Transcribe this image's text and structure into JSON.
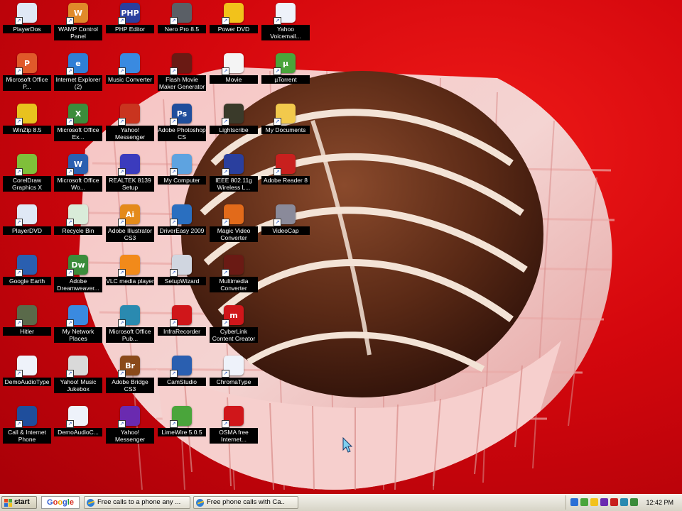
{
  "desktop": {
    "icons": [
      {
        "label": "PlayerDos",
        "icon": "dvd-disc-icon",
        "color": "#dfe8f5",
        "glyph": "",
        "col": 0,
        "row": 0
      },
      {
        "label": "WAMP Control Panel",
        "icon": "wamp-panel-icon",
        "color": "#e08a2a",
        "glyph": "W",
        "col": 1,
        "row": 0
      },
      {
        "label": "PHP Editor",
        "icon": "php-editor-icon",
        "color": "#2b3f9e",
        "glyph": "PHP",
        "col": 2,
        "row": 0
      },
      {
        "label": "Nero Pro 8.5",
        "icon": "disc-burner-icon",
        "color": "#5a5f66",
        "glyph": "",
        "col": 3,
        "row": 0
      },
      {
        "label": "Power DVD",
        "icon": "power-dvd-icon",
        "color": "#f2c21b",
        "glyph": "",
        "col": 4,
        "row": 0
      },
      {
        "label": "Yahoo Voicemail...",
        "icon": "document-icon",
        "color": "#eef2fa",
        "glyph": "",
        "col": 5,
        "row": 0
      },
      {
        "label": "Microsoft Office P...",
        "icon": "powerpoint-icon",
        "color": "#e0592a",
        "glyph": "P",
        "col": 0,
        "row": 1
      },
      {
        "label": "Internet Explorer (2)",
        "icon": "internet-explorer-icon",
        "color": "#2f7fd6",
        "glyph": "e",
        "col": 1,
        "row": 1
      },
      {
        "label": "Music Converter",
        "icon": "music-converter-icon",
        "color": "#3a8ae0",
        "glyph": "",
        "col": 2,
        "row": 1
      },
      {
        "label": "Flash Movie Maker Generator",
        "icon": "flash-maker-icon",
        "color": "#6a1a14",
        "glyph": "",
        "col": 3,
        "row": 1
      },
      {
        "label": "Movie",
        "icon": "movie-file-icon",
        "color": "#f4f4f4",
        "glyph": "",
        "col": 4,
        "row": 1
      },
      {
        "label": "µTorrent",
        "icon": "utorrent-icon",
        "color": "#4aa53b",
        "glyph": "µ",
        "col": 5,
        "row": 1
      },
      {
        "label": "WinZip 8.5",
        "icon": "winzip-icon",
        "color": "#e8c21e",
        "glyph": "",
        "col": 0,
        "row": 2
      },
      {
        "label": "Microsoft Office Ex...",
        "icon": "excel-icon",
        "color": "#3b8c3b",
        "glyph": "X",
        "col": 1,
        "row": 2
      },
      {
        "label": "Yahoo! Messenger",
        "icon": "messenger-icon",
        "color": "#c9341f",
        "glyph": "",
        "col": 2,
        "row": 2
      },
      {
        "label": "Adobe Photoshop CS",
        "icon": "photoshop-icon",
        "color": "#1f4e9c",
        "glyph": "Ps",
        "col": 3,
        "row": 2
      },
      {
        "label": "Lightscribe",
        "icon": "lightscribe-icon",
        "color": "#3a3a2a",
        "glyph": "",
        "col": 4,
        "row": 2
      },
      {
        "label": "My Documents",
        "icon": "folder-icon",
        "color": "#f2c94c",
        "glyph": "",
        "col": 5,
        "row": 2
      },
      {
        "label": "CorelDraw Graphics X",
        "icon": "coreldraw-icon",
        "color": "#7fbf3a",
        "glyph": "",
        "col": 0,
        "row": 3
      },
      {
        "label": "Microsoft Office Wo...",
        "icon": "word-icon",
        "color": "#2a5fb0",
        "glyph": "W",
        "col": 1,
        "row": 3
      },
      {
        "label": "REALTEK 8139 Setup",
        "icon": "realtek-icon",
        "color": "#3b3bbd",
        "glyph": "",
        "col": 2,
        "row": 3
      },
      {
        "label": "My Computer",
        "icon": "my-computer-icon",
        "color": "#5ea3e0",
        "glyph": "",
        "col": 3,
        "row": 3
      },
      {
        "label": "IEEE 802.11g Wireless L...",
        "icon": "wireless-icon",
        "color": "#2a3f9e",
        "glyph": "",
        "col": 4,
        "row": 3
      },
      {
        "label": "Adobe Reader 8",
        "icon": "adobe-reader-icon",
        "color": "#c8201e",
        "glyph": "",
        "col": 5,
        "row": 3
      },
      {
        "label": "PlayerDVD",
        "icon": "dvd-disc-icon",
        "color": "#dfe8f5",
        "glyph": "",
        "col": 0,
        "row": 4
      },
      {
        "label": "Recycle Bin",
        "icon": "recycle-bin-icon",
        "color": "#d9ecd9",
        "glyph": "",
        "col": 1,
        "row": 4
      },
      {
        "label": "Adobe Illustrator CS3",
        "icon": "illustrator-icon",
        "color": "#e48a1a",
        "glyph": "Ai",
        "col": 2,
        "row": 4
      },
      {
        "label": "DriverEasy 2009",
        "icon": "driver-easy-icon",
        "color": "#2a6fc0",
        "glyph": "",
        "col": 3,
        "row": 4
      },
      {
        "label": "Magic Video Converter",
        "icon": "video-converter-icon",
        "color": "#e26a1a",
        "glyph": "",
        "col": 4,
        "row": 4
      },
      {
        "label": "VideoCap",
        "icon": "videocap-icon",
        "color": "#8a8a9a",
        "glyph": "",
        "col": 5,
        "row": 4
      },
      {
        "label": "Google Earth",
        "icon": "google-earth-icon",
        "color": "#2a5fb0",
        "glyph": "",
        "col": 0,
        "row": 5
      },
      {
        "label": "Adobe Dreamweaver...",
        "icon": "dreamweaver-icon",
        "color": "#3b8c3b",
        "glyph": "Dw",
        "col": 1,
        "row": 5
      },
      {
        "label": "VLC media player",
        "icon": "vlc-icon",
        "color": "#f28a1a",
        "glyph": "",
        "col": 2,
        "row": 5
      },
      {
        "label": "SetupWizard",
        "icon": "setup-wizard-icon",
        "color": "#d0d6e0",
        "glyph": "",
        "col": 3,
        "row": 5
      },
      {
        "label": "Multimedia Converter",
        "icon": "multimedia-converter-icon",
        "color": "#6a1a14",
        "glyph": "",
        "col": 4,
        "row": 5
      },
      {
        "label": "Hitler",
        "icon": "game-icon",
        "color": "#5a6a4a",
        "glyph": "",
        "col": 0,
        "row": 6
      },
      {
        "label": "My Network Places",
        "icon": "network-places-icon",
        "color": "#3a8ae0",
        "glyph": "",
        "col": 1,
        "row": 6
      },
      {
        "label": "Microsoft Office Pub...",
        "icon": "publisher-icon",
        "color": "#2a8ab0",
        "glyph": "",
        "col": 2,
        "row": 6
      },
      {
        "label": "InfraRecorder",
        "icon": "infrarecorder-icon",
        "color": "#d0161a",
        "glyph": "",
        "col": 3,
        "row": 6
      },
      {
        "label": "CyberLink Content Creator",
        "icon": "cyberlink-icon",
        "color": "#d0161a",
        "glyph": "m",
        "col": 4,
        "row": 6
      },
      {
        "label": "DemoAudioType",
        "icon": "document-icon",
        "color": "#eef2fa",
        "glyph": "",
        "col": 0,
        "row": 7
      },
      {
        "label": "Yahoo! Music Jukebox",
        "icon": "jukebox-icon",
        "color": "#d9d9d9",
        "glyph": "",
        "col": 1,
        "row": 7
      },
      {
        "label": "Adobe Bridge CS3",
        "icon": "adobe-bridge-icon",
        "color": "#8a4a1a",
        "glyph": "Br",
        "col": 2,
        "row": 7
      },
      {
        "label": "CamStudio",
        "icon": "camstudio-icon",
        "color": "#2a5fb0",
        "glyph": "",
        "col": 3,
        "row": 7
      },
      {
        "label": "ChromaType",
        "icon": "document-icon",
        "color": "#eef2fa",
        "glyph": "",
        "col": 4,
        "row": 7
      },
      {
        "label": "Call & Internet Phone",
        "icon": "phone-icon",
        "color": "#1f4e9c",
        "glyph": "",
        "col": 0,
        "row": 8
      },
      {
        "label": "DemoAudioC...",
        "icon": "document-icon",
        "color": "#eef2fa",
        "glyph": "",
        "col": 1,
        "row": 8
      },
      {
        "label": "Yahoo! Messenger",
        "icon": "yahoo-messenger-icon",
        "color": "#6a2ab0",
        "glyph": "",
        "col": 2,
        "row": 8
      },
      {
        "label": "LimeWire 5.0.5",
        "icon": "limewire-icon",
        "color": "#4aa53b",
        "glyph": "",
        "col": 3,
        "row": 8
      },
      {
        "label": "OSMA free Internet...",
        "icon": "osma-icon",
        "color": "#d0161a",
        "glyph": "",
        "col": 4,
        "row": 8
      }
    ]
  },
  "taskbar": {
    "start_label": "start",
    "google_label": "Google",
    "tasks": [
      {
        "label": "Free calls to a phone any ...",
        "icon": "internet-explorer-icon"
      },
      {
        "label": "Free phone calls with Ca..",
        "icon": "internet-explorer-icon"
      }
    ],
    "clock": "12:42 PM"
  },
  "colors": {
    "wallpaper_red": "#d4070d",
    "taskbar_bg": "#e5e2d6",
    "label_bg": "#000000"
  }
}
